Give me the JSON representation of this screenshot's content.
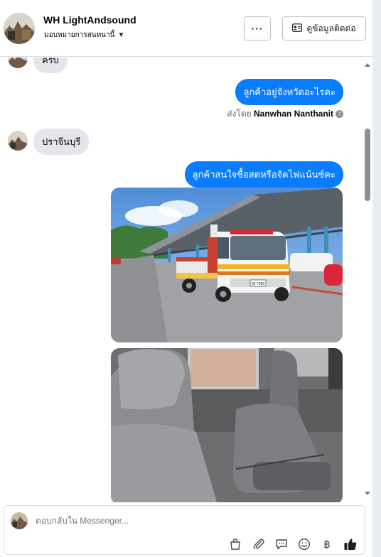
{
  "header": {
    "title": "WH LightAndsound",
    "subtitle": "มอบหมายการสนทนานี้",
    "more_label": "···",
    "contact_label": "ดูข้อมูลติดต่อ"
  },
  "messages": {
    "cut_message": "ครับ",
    "out_1": "ลูกค้าอยู่จังหวัดอะไรคะ",
    "sent_by_prefix": "ส่งโดย",
    "sent_by_name": "Nanwhan Nanthanit",
    "in_1": "ปราจีนบุรี",
    "out_2": "ลูกค้าสนใจซื้อสดหรือจัดไฟแน้นซ์คะ",
    "photo_1_plate": "82-7989"
  },
  "composer": {
    "placeholder": "ตอบกลับใน Messenger..."
  },
  "colors": {
    "outgoing_bubble": "#0a7cff",
    "incoming_bubble": "#e4e6eb",
    "like_icon": "#1c1e21"
  },
  "icons": [
    "more-icon",
    "contact-card-icon",
    "shopping-bag-icon",
    "paperclip-icon",
    "saved-reply-icon",
    "emoji-icon",
    "baht-icon",
    "thumbs-up-icon",
    "question-icon",
    "chevron-down-icon"
  ]
}
